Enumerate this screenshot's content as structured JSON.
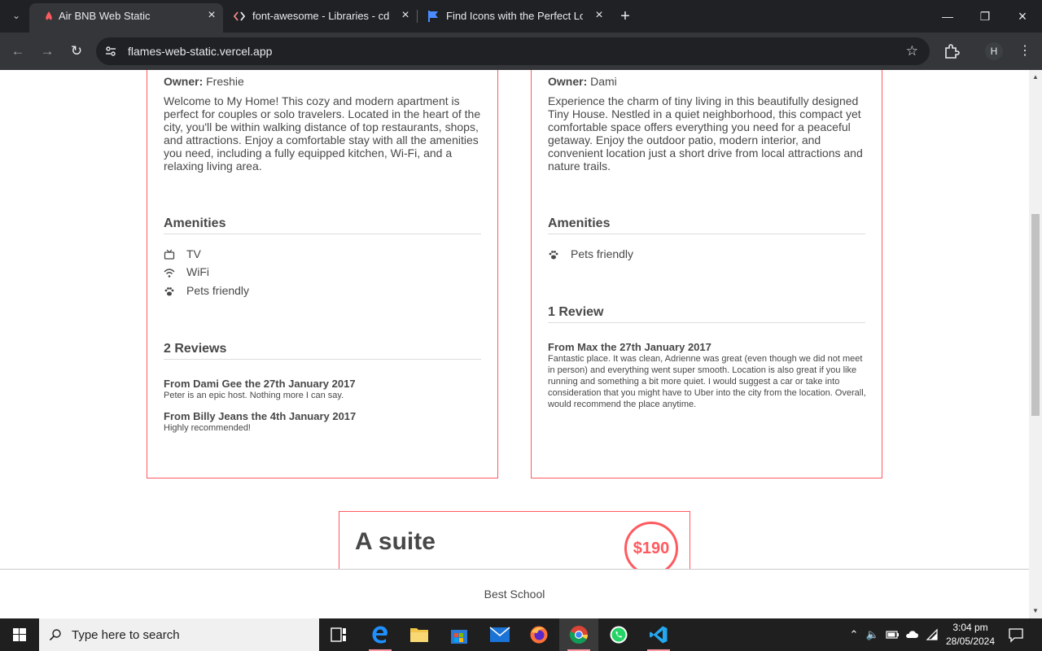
{
  "browser": {
    "tabs": [
      {
        "title": "Air BNB Web Static",
        "icon": "airbnb-favicon"
      },
      {
        "title": "font-awesome - Libraries - cdnjs",
        "icon": "code-brackets-icon"
      },
      {
        "title": "Find Icons with the Perfect Look",
        "icon": "flag-favicon"
      }
    ],
    "url": "flames-web-static.vercel.app",
    "profile_initial": "H"
  },
  "places": [
    {
      "owner_label": "Owner:",
      "owner": "Freshie",
      "description": "Welcome to My Home! This cozy and modern apartment is perfect for couples or solo travelers. Located in the heart of the city, you'll be within walking distance of top restaurants, shops, and attractions. Enjoy a comfortable stay with all the amenities you need, including a fully equipped kitchen, Wi-Fi, and a relaxing living area.",
      "amenities_title": "Amenities",
      "amenities": [
        {
          "label": "TV",
          "icon": "tv-icon"
        },
        {
          "label": "WiFi",
          "icon": "wifi-icon"
        },
        {
          "label": "Pets friendly",
          "icon": "paw-icon"
        }
      ],
      "reviews_title": "2 Reviews",
      "reviews": [
        {
          "heading": "From Dami Gee the 27th January 2017",
          "text": "Peter is an epic host. Nothing more I can say."
        },
        {
          "heading": "From Billy Jeans the 4th January 2017",
          "text": "Highly recommended!"
        }
      ]
    },
    {
      "owner_label": "Owner:",
      "owner": "Dami",
      "description": "Experience the charm of tiny living in this beautifully designed Tiny House. Nestled in a quiet neighborhood, this compact yet comfortable space offers everything you need for a peaceful getaway. Enjoy the outdoor patio, modern interior, and convenient location just a short drive from local attractions and nature trails.",
      "amenities_title": "Amenities",
      "amenities": [
        {
          "label": "Pets friendly",
          "icon": "paw-icon"
        }
      ],
      "reviews_title": "1 Review",
      "reviews": [
        {
          "heading": "From Max the 27th January 2017",
          "text": "Fantastic place. It was clean, Adrienne was great (even though we did not meet in person) and everything went super smooth. Location is also great if you like running and something a bit more quiet. I would suggest a car or take into consideration that you might have to Uber into the city from the location. Overall, would recommend the place anytime."
        }
      ]
    }
  ],
  "suite": {
    "title": "A suite",
    "price": "$190"
  },
  "footer": {
    "text": "Best School"
  },
  "taskbar": {
    "search_placeholder": "Type here to search",
    "time": "3:04 pm",
    "date": "28/05/2024"
  },
  "colors": {
    "accent": "#ff5a5f",
    "text": "#484848"
  }
}
